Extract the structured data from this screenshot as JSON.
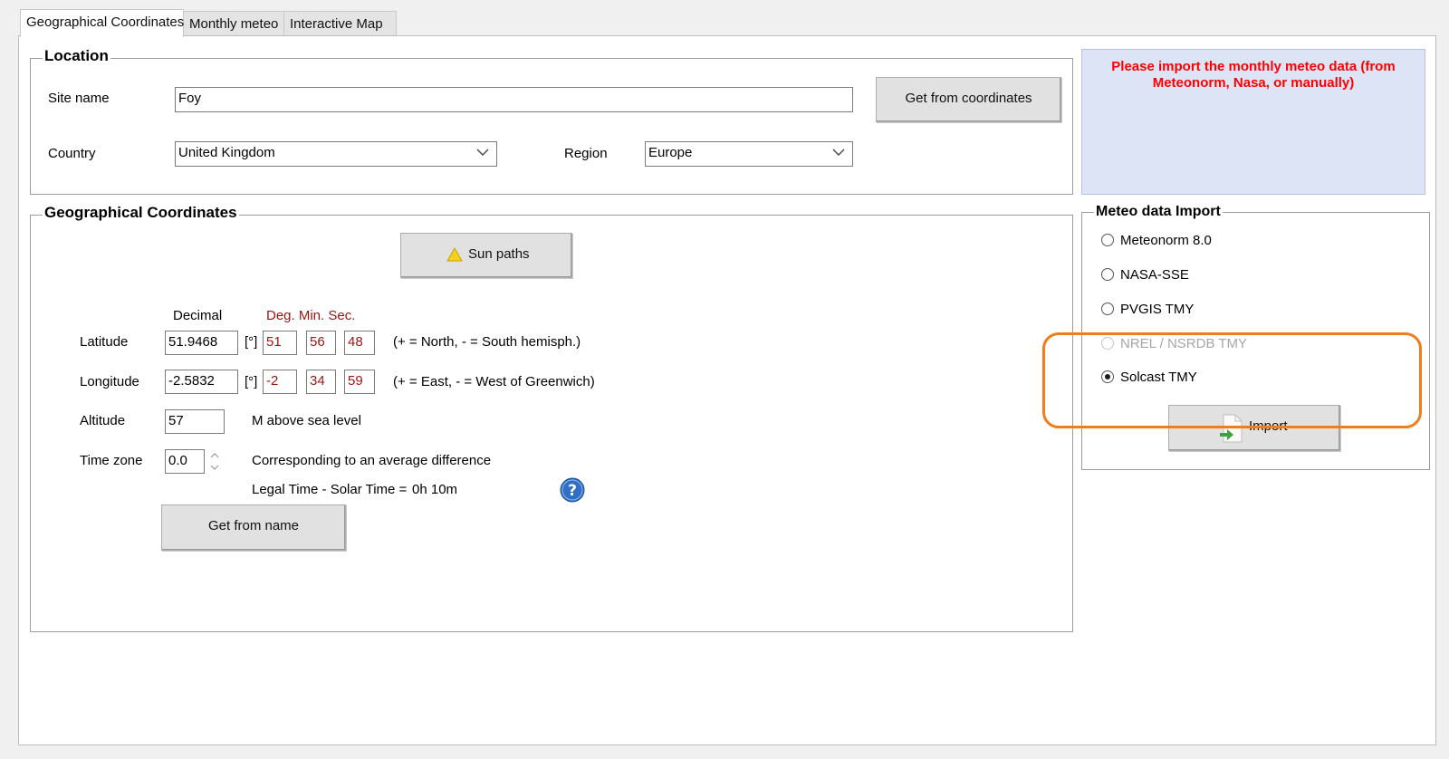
{
  "tabs": [
    {
      "label": "Geographical Coordinates",
      "active": true
    },
    {
      "label": "Monthly meteo",
      "active": false
    },
    {
      "label": "Interactive Map",
      "active": false
    }
  ],
  "location": {
    "title": "Location",
    "site_name_label": "Site name",
    "site_name_value": "Foy",
    "get_from_coordinates": "Get from coordinates",
    "country_label": "Country",
    "country_value": "United Kingdom",
    "region_label": "Region",
    "region_value": "Europe"
  },
  "notice": {
    "text": "Please import the monthly meteo data (from Meteonorm, Nasa, or manually)",
    "color": "#ff0000",
    "background": "#dce4f6"
  },
  "geo": {
    "title": "Geographical Coordinates",
    "sun_paths": "Sun paths",
    "decimal_header": "Decimal",
    "dms_header": "Deg. Min. Sec.",
    "latitude_label": "Latitude",
    "latitude_decimal": "51.9468",
    "latitude_deg": "51",
    "latitude_min": "56",
    "latitude_sec": "48",
    "latitude_hint": "(+ = North, - = South hemisph.)",
    "longitude_label": "Longitude",
    "longitude_decimal": "-2.5832",
    "longitude_deg": "-2",
    "longitude_min": "34",
    "longitude_sec": "59",
    "longitude_hint": "(+ = East, - = West of Greenwich)",
    "unit_deg": "[°]",
    "altitude_label": "Altitude",
    "altitude_value": "57",
    "altitude_unit": "M above sea level",
    "timezone_label": "Time zone",
    "timezone_value": "0.0",
    "timezone_hint": "Corresponding to an average difference",
    "legal_time_label": "Legal Time - Solar Time =",
    "legal_time_value": "0h 10m",
    "get_from_name": "Get from name"
  },
  "meteo_import": {
    "title": "Meteo data Import",
    "options": [
      {
        "label": "Meteonorm 8.0",
        "selected": false,
        "disabled": false
      },
      {
        "label": "NASA-SSE",
        "selected": false,
        "disabled": false
      },
      {
        "label": "PVGIS TMY",
        "selected": false,
        "disabled": false
      },
      {
        "label": "NREL / NSRDB TMY",
        "selected": false,
        "disabled": true
      },
      {
        "label": "Solcast TMY",
        "selected": true,
        "disabled": false
      }
    ],
    "import_button": "Import",
    "highlight_color": "#f07d1a"
  }
}
